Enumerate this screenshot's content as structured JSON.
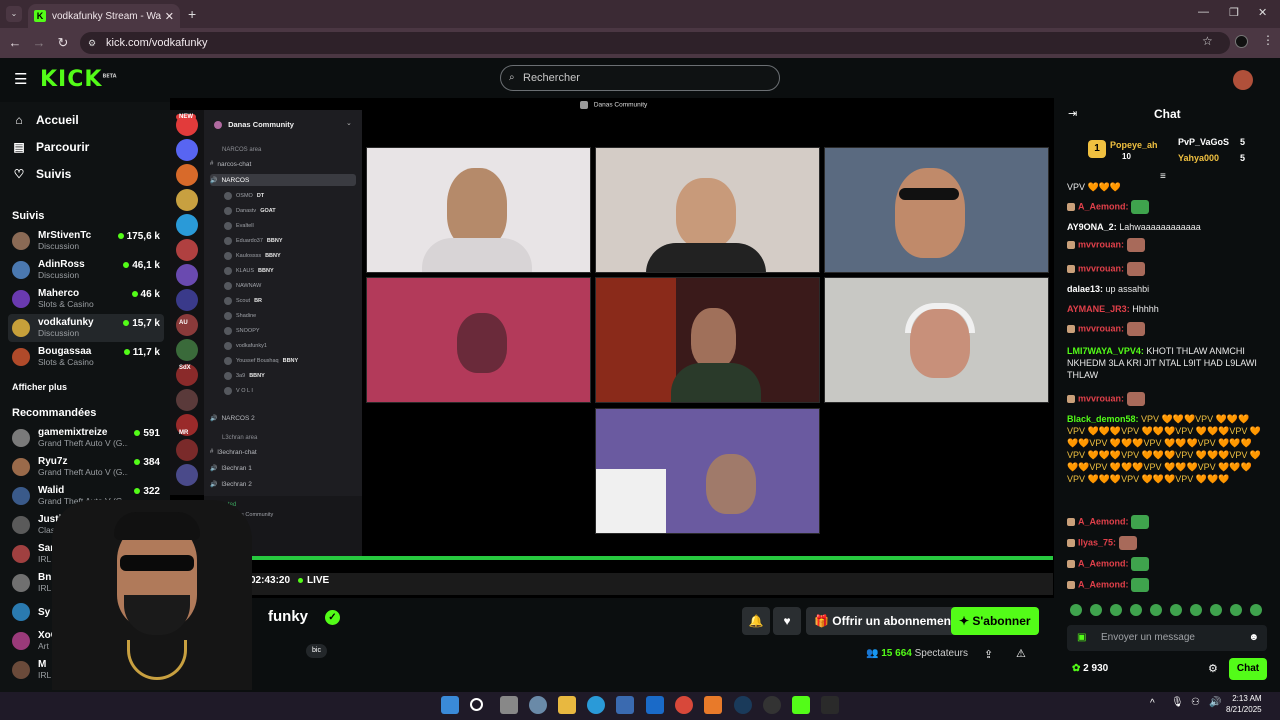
{
  "browser": {
    "tab_title": "vodkafunky Stream - Watch Liv",
    "url": "kick.com/vodkafunky"
  },
  "header": {
    "logo": "KICK",
    "logo_badge": "BETA",
    "search_placeholder": "Rechercher"
  },
  "nav": [
    {
      "label": "Accueil",
      "icon": "home-icon"
    },
    {
      "label": "Parcourir",
      "icon": "browse-icon"
    },
    {
      "label": "Suivis",
      "icon": "heart-icon"
    }
  ],
  "following": {
    "title": "Suivis",
    "channels": [
      {
        "name": "MrStivenTc",
        "category": "Discussion",
        "viewers": "175,6 k",
        "color": "#8a6a55"
      },
      {
        "name": "AdinRoss",
        "category": "Discussion",
        "viewers": "46,1 k",
        "color": "#4a78b0"
      },
      {
        "name": "Maherco",
        "category": "Slots & Casino",
        "viewers": "46 k",
        "color": "#6a3ab0"
      },
      {
        "name": "vodkafunky",
        "category": "Discussion",
        "viewers": "15,7 k",
        "color": "#c7a03a"
      },
      {
        "name": "Bougassaa",
        "category": "Slots & Casino",
        "viewers": "11,7 k",
        "color": "#b04a2a"
      }
    ],
    "see_more": "Afficher plus"
  },
  "recommended": {
    "title": "Recommandées",
    "channels": [
      {
        "name": "gamemixtreize",
        "category": "Grand Theft Auto V (G...",
        "viewers": "591",
        "color": "#7a7a7a"
      },
      {
        "name": "Ryu7z",
        "category": "Grand Theft Auto V (G...",
        "viewers": "384",
        "color": "#9a6a4a"
      },
      {
        "name": "Walid",
        "category": "Grand Theft Auto V (G...",
        "viewers": "322",
        "color": "#3a5a8a"
      },
      {
        "name": "JustinBarrett",
        "category": "Clash Royale",
        "viewers": "",
        "color": "#5a5a5a"
      },
      {
        "name": "SamXFran",
        "category": "IRL",
        "viewers": "",
        "color": "#a04040"
      },
      {
        "name": "BnBr",
        "category": "IRL",
        "viewers": "",
        "color": "#707070"
      },
      {
        "name": "Sy",
        "category": "",
        "viewers": "",
        "color": "#2a7ab0"
      },
      {
        "name": "XoC",
        "category": "Art",
        "viewers": "",
        "color": "#9a3a7a"
      },
      {
        "name": "M",
        "category": "IRL",
        "viewers": "",
        "color": "#6a4a3a"
      }
    ]
  },
  "discord": {
    "window_title": "Danas Community",
    "server_name": "Danas Community",
    "categories": [
      "NARCOS area",
      "L3chran area"
    ],
    "channels": [
      "narcos-chat",
      "NARCOS",
      "NARCOS 2",
      "l3echran-chat",
      "l3echran 1",
      "l3echran 2"
    ],
    "users": [
      "OSMO",
      "Danastv",
      "Evaltell",
      "Eduardo37",
      "Kaulossss",
      "KLAUS",
      "NAWNAW",
      "Scout",
      "Shadine",
      "SNOOPY",
      "vodkafunky1",
      "Youssef Boushaq",
      "3a9",
      "V O L I"
    ],
    "user_tags": [
      "DT",
      "GOAT",
      "BBNY",
      "BBNY",
      "BBNY",
      "BR",
      "BBNY",
      "BBNY"
    ],
    "server_labels": [
      "NEW",
      "AU",
      "SdX",
      "MR"
    ],
    "footer_server": "Danas Community",
    "footer_status": "ted"
  },
  "stream": {
    "timer": "02:43:20",
    "live_label": "LIVE"
  },
  "channel_info": {
    "name": "vodkafunky",
    "name_visible": "funky",
    "tag": "bic",
    "subscribe_gift": "Offrir un abonnement",
    "subscribe": "S'abonner",
    "viewers_count": "15 664",
    "viewers_label": "Spectateurs"
  },
  "chat": {
    "title": "Chat",
    "pinned": [
      {
        "name": "Popeye_ah",
        "count": "10",
        "color": "#f0c040"
      },
      {
        "name": "PvP_VaGoS",
        "count": "5",
        "color": "#ffffff"
      },
      {
        "name": "Yahya000",
        "count": "5",
        "color": "#f0c040"
      }
    ],
    "messages": [
      {
        "user": "",
        "text": "VPV 🧡🧡🧡",
        "color": "#eaeaea"
      },
      {
        "user": "A_Aemond:",
        "text": "",
        "color": "#e0404a",
        "emote": true
      },
      {
        "user": "AY9ONA_2:",
        "text": "Lahwaaaaaaaaaaaa",
        "color": "#ffffff"
      },
      {
        "user": "mvvrouan:",
        "text": "",
        "color": "#e0404a",
        "emote": true
      },
      {
        "user": "mvvrouan:",
        "text": "",
        "color": "#e0404a",
        "emote": true
      },
      {
        "user": "dalae13:",
        "text": "up assahbi",
        "color": "#ffffff"
      },
      {
        "user": "AYMANE_JR3:",
        "text": "Hhhhh",
        "color": "#e0404a"
      },
      {
        "user": "mvvrouan:",
        "text": "",
        "color": "#e0404a",
        "emote": true
      },
      {
        "user": "LMI7WAYA_VPV4:",
        "text": "KHOTI THLAW ANMCHI NKHEDM 3LA KRI JIT NTAL L9IT HAD L9LAWI THLAW",
        "color": "#53fc18"
      },
      {
        "user": "mvvrouan:",
        "text": "",
        "color": "#e0404a",
        "emote": true
      },
      {
        "user": "Black_demon58:",
        "text": "VPV 🧡🧡🧡VPV 🧡🧡🧡VPV 🧡🧡🧡VPV 🧡🧡🧡VPV 🧡🧡🧡VPV 🧡🧡🧡VPV 🧡🧡🧡VPV 🧡🧡🧡VPV 🧡🧡🧡VPV 🧡🧡🧡VPV 🧡🧡🧡VPV 🧡🧡🧡VPV 🧡🧡🧡VPV 🧡🧡🧡VPV 🧡🧡🧡VPV 🧡🧡🧡VPV 🧡🧡🧡VPV 🧡🧡🧡VPV 🧡🧡🧡",
        "color": "#53fc18"
      },
      {
        "user": "A_Aemond:",
        "text": "",
        "color": "#e0404a",
        "emote": true
      },
      {
        "user": "Ilyas_75:",
        "text": "",
        "color": "#e0404a",
        "emote": true
      },
      {
        "user": "A_Aemond:",
        "text": "",
        "color": "#e0404a",
        "emote": true
      },
      {
        "user": "A_Aemond:",
        "text": "",
        "color": "#e0404a",
        "emote": true
      }
    ],
    "input_placeholder": "Envoyer un message",
    "points": "2 930",
    "send_label": "Chat"
  },
  "taskbar": {
    "time": "2:13 AM",
    "date": "8/21/2025"
  }
}
